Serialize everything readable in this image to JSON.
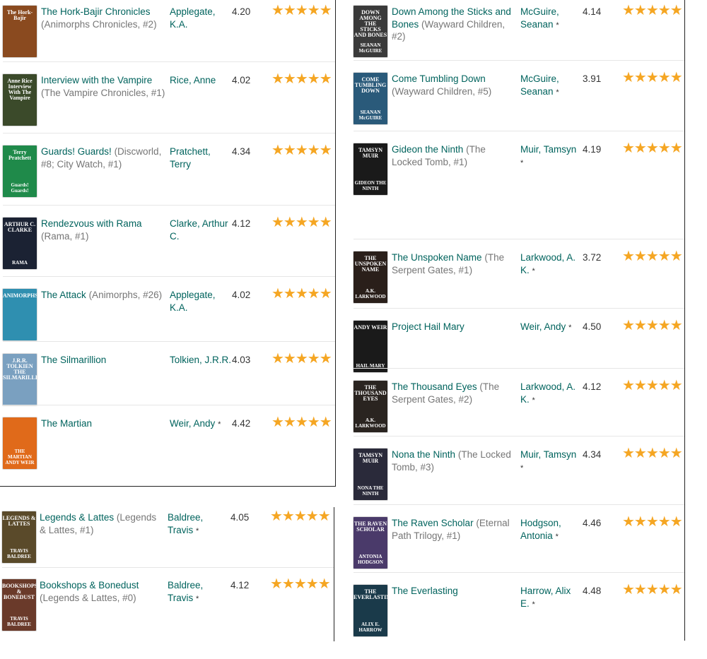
{
  "colors": {
    "link": "#00635d",
    "series": "#767676",
    "star": "#f5a623"
  },
  "left": [
    {
      "title": "The Hork-Bajir Chronicles",
      "series": "(Animorphs Chronicles, #2)",
      "author": "Applegate, K.A.",
      "author_star": "",
      "rating": "4.20",
      "stars": "★★★★★",
      "cover": {
        "bg": "#8a4a1f",
        "t1": "The Hork-Bajir",
        "t2": ""
      }
    },
    {
      "title": "Interview with the Vampire",
      "series": "(The Vampire Chronicles, #1)",
      "author": "Rice, Anne",
      "author_star": "",
      "rating": "4.02",
      "stars": "★★★★★",
      "cover": {
        "bg": "#3b4a2a",
        "t1": "Anne Rice Interview With The Vampire",
        "t2": ""
      }
    },
    {
      "title": "Guards! Guards!",
      "series": "(Discworld, #8; City Watch, #1)",
      "author": "Pratchett, Terry",
      "author_star": "",
      "rating": "4.34",
      "stars": "★★★★★",
      "cover": {
        "bg": "#1f8a4a",
        "t1": "Terry Pratchett",
        "t2": "Guards! Guards!"
      }
    },
    {
      "title": "Rendezvous with Rama",
      "series": "(Rama, #1)",
      "author": "Clarke, Arthur C.",
      "author_star": "",
      "rating": "4.12",
      "stars": "★★★★★",
      "cover": {
        "bg": "#1b2233",
        "t1": "ARTHUR C. CLARKE",
        "t2": "RAMA"
      }
    },
    {
      "title": "The Attack",
      "series": "(Animorphs, #26)",
      "author": "Applegate, K.A.",
      "author_star": "",
      "rating": "4.02",
      "stars": "★★★★★",
      "cover": {
        "bg": "#2f8fb0",
        "t1": "ANIMORPHS",
        "t2": ""
      }
    },
    {
      "title": "The Silmarillion",
      "series": "",
      "author": "Tolkien, J.R.R.",
      "author_star": "",
      "rating": "4.03",
      "stars": "★★★★★",
      "cover": {
        "bg": "#7aa0c0",
        "t1": "J.R.R. TOLKIEN THE SILMARILLION",
        "t2": ""
      }
    },
    {
      "title": "The Martian",
      "series": "",
      "author": "Weir, Andy",
      "author_star": "*",
      "rating": "4.42",
      "stars": "★★★★★",
      "cover": {
        "bg": "#e06a1a",
        "t1": "",
        "t2": "THE MARTIAN ANDY WEIR"
      }
    },
    {
      "title": "Legends & Lattes",
      "series": "(Legends & Lattes, #1)",
      "author": "Baldree, Travis",
      "author_star": "*",
      "rating": "4.05",
      "stars": "★★★★★",
      "cover": {
        "bg": "#5a4a2a",
        "t1": "LEGENDS & LATTES",
        "t2": "TRAVIS BALDREE"
      }
    },
    {
      "title": "Bookshops & Bonedust",
      "series": "(Legends & Lattes, #0)",
      "author": "Baldree, Travis",
      "author_star": "*",
      "rating": "4.12",
      "stars": "★★★★★",
      "cover": {
        "bg": "#6a3a2a",
        "t1": "BOOKSHOPS & BONEDUST",
        "t2": "TRAVIS BALDREE"
      }
    }
  ],
  "right": [
    {
      "title": "Down Among the Sticks and Bones",
      "series": "(Wayward Children, #2)",
      "author": "McGuire, Seanan",
      "author_star": "*",
      "rating": "4.14",
      "stars": "★★★★★",
      "cover": {
        "bg": "#3a3a3a",
        "t1": "DOWN AMONG THE STICKS AND BONES",
        "t2": "SEANAN McGUIRE"
      }
    },
    {
      "title": "Come Tumbling Down",
      "series": "(Wayward Children, #5)",
      "author": "McGuire, Seanan",
      "author_star": "*",
      "rating": "3.91",
      "stars": "★★★★★",
      "cover": {
        "bg": "#2a5a7a",
        "t1": "COME TUMBLING DOWN",
        "t2": "SEANAN McGUIRE"
      }
    },
    {
      "title": "Gideon the Ninth",
      "series": "(The Locked Tomb, #1)",
      "author": "Muir, Tamsyn",
      "author_star": "*",
      "rating": "4.19",
      "stars": "★★★★★",
      "cover": {
        "bg": "#1a1a1a",
        "t1": "TAMSYN MUIR",
        "t2": "GIDEON THE NINTH"
      }
    },
    {
      "title": "The Unspoken Name",
      "series": "(The Serpent Gates, #1)",
      "author": "Larkwood, A. K.",
      "author_star": "*",
      "rating": "3.72",
      "stars": "★★★★★",
      "cover": {
        "bg": "#2a1f1a",
        "t1": "THE UNSPOKEN NAME",
        "t2": "A.K. LARKWOOD"
      }
    },
    {
      "title": "Project Hail Mary",
      "series": "",
      "author": "Weir, Andy",
      "author_star": "*",
      "rating": "4.50",
      "stars": "★★★★★",
      "cover": {
        "bg": "#1a1a1a",
        "t1": "ANDY WEIR",
        "t2": "HAIL MARY"
      }
    },
    {
      "title": "The Thousand Eyes",
      "series": "(The Serpent Gates, #2)",
      "author": "Larkwood, A. K.",
      "author_star": "*",
      "rating": "4.12",
      "stars": "★★★★★",
      "cover": {
        "bg": "#2a2420",
        "t1": "THE THOUSAND EYES",
        "t2": "A.K. LARKWOOD"
      }
    },
    {
      "title": "Nona the Ninth",
      "series": "(The Locked Tomb, #3)",
      "author": "Muir, Tamsyn",
      "author_star": "*",
      "rating": "4.34",
      "stars": "★★★★★",
      "cover": {
        "bg": "#2a2a3a",
        "t1": "TAMSYN MUIR",
        "t2": "NONA THE NINTH"
      }
    },
    {
      "title": "The Raven Scholar",
      "series": "(Eternal Path Trilogy, #1)",
      "author": "Hodgson, Antonia",
      "author_star": "*",
      "rating": "4.46",
      "stars": "★★★★★",
      "cover": {
        "bg": "#4a3a6a",
        "t1": "THE RAVEN SCHOLAR",
        "t2": "ANTONIA HODGSON"
      }
    },
    {
      "title": "The Everlasting",
      "series": "",
      "author": "Harrow, Alix E.",
      "author_star": "*",
      "rating": "4.48",
      "stars": "★★★★★",
      "cover": {
        "bg": "#1a3a4a",
        "t1": "THE EVERLASTING",
        "t2": "ALIX E. HARROW"
      }
    }
  ]
}
